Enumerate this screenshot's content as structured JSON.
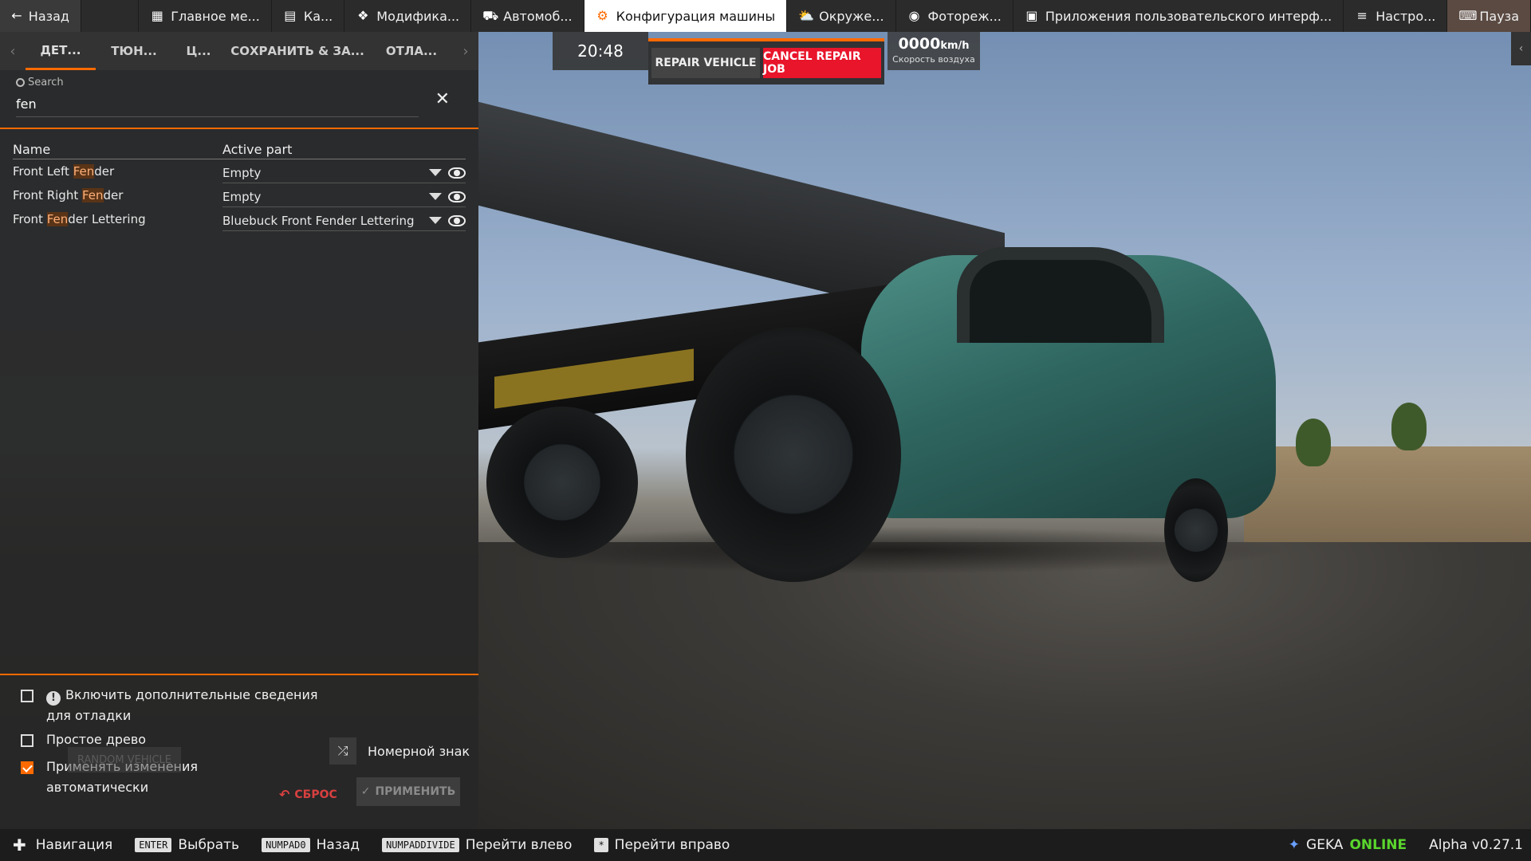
{
  "topbar": {
    "back": "Назад",
    "items": [
      {
        "label": "Главное ме...",
        "icon": "grid-icon"
      },
      {
        "label": "Ка...",
        "icon": "map-icon"
      },
      {
        "label": "Модифика...",
        "icon": "puzzle-icon"
      },
      {
        "label": "Автомоб...",
        "icon": "car-icon"
      },
      {
        "label": "Конфигурация машины",
        "icon": "engine-icon",
        "active": true
      },
      {
        "label": "Окруже...",
        "icon": "weather-icon"
      },
      {
        "label": "Фотореж...",
        "icon": "camera-icon"
      },
      {
        "label": "Приложения пользовательского интерф...",
        "icon": "apps-icon"
      },
      {
        "label": "Настро...",
        "icon": "sliders-icon"
      }
    ],
    "pause": "Пауза"
  },
  "tabs": [
    "ДЕТ...",
    "ТЮН...",
    "Ц...",
    "СОХРАНИТЬ & ЗА...",
    "ОТЛА..."
  ],
  "search": {
    "label": "Search",
    "value": "fen"
  },
  "parts": {
    "col_name": "Name",
    "col_part": "Active part",
    "rows": [
      {
        "pre": "Front Left ",
        "hit": "Fen",
        "post": "der",
        "part": "Empty"
      },
      {
        "pre": "Front Right ",
        "hit": "Fen",
        "post": "der",
        "part": "Empty"
      },
      {
        "pre": "Front ",
        "hit": "Fen",
        "post": "der Lettering",
        "part": "Bluebuck Front Fender Lettering"
      }
    ]
  },
  "options": {
    "debug_line1": "Включить дополнительные сведения",
    "debug_line2": "для отладки",
    "simple_tree": "Простое древо",
    "auto_line1": "Применять изменения",
    "auto_line2": "автоматически",
    "auto_checked": true,
    "ghost": "RANDOM VEHICLE",
    "plate": "Номерной знак",
    "reset": "СБРОС",
    "apply": "ПРИМЕНИТЬ"
  },
  "hud": {
    "clock": "20:48",
    "repair": "REPAIR VEHICLE",
    "cancel": "CANCEL REPAIR JOB",
    "speed": "0000",
    "speed_unit": "km/h",
    "speed_label": "Скорость воздуха"
  },
  "bottombar": {
    "nav": "Навигация",
    "k_enter": "ENTER",
    "select": "Выбрать",
    "k_back": "NUMPAD0",
    "back": "Назад",
    "k_left": "NUMPADDIVIDE",
    "left": "Перейти влево",
    "k_right": "*",
    "right": "Перейти вправо",
    "user": "GEKA",
    "status": "ONLINE",
    "version": "Alpha v0.27.1"
  },
  "colors": {
    "accent": "#ff6a00",
    "cancel": "#e8152b",
    "online": "#5ad62d"
  }
}
